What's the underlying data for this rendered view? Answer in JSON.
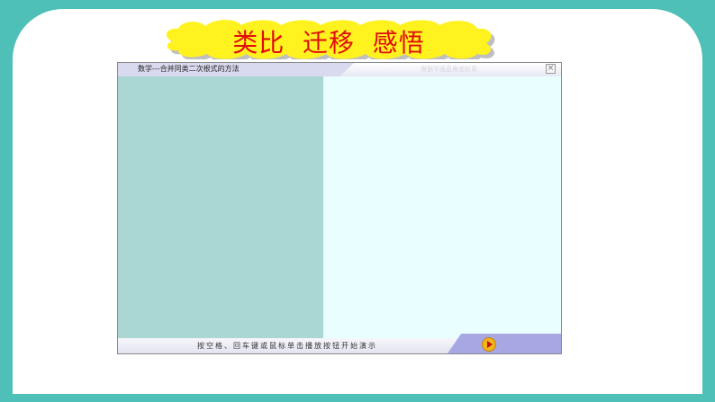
{
  "slide": {
    "title": "类比  迁移  感悟"
  },
  "player": {
    "window_title": "数学---合并同类二次根式的方法",
    "faint_text": "根据平面直角坐标系",
    "close_label": "×",
    "instruction": "按空格、回车键或鼠标单击播放按钮开始演示"
  },
  "colors": {
    "background_teal": "#4fc0b8",
    "title_red": "#e00d0d",
    "cloud_yellow": "#fff21e",
    "left_pane": "#aad6d4",
    "right_pane": "#e9ffff"
  }
}
